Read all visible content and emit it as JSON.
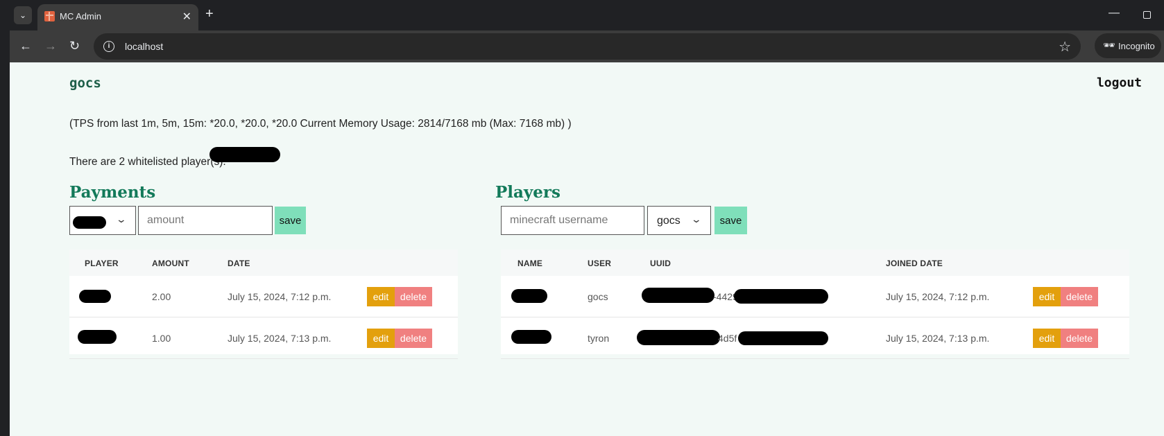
{
  "browser": {
    "tab_title": "MC Admin",
    "tab_close": "✕",
    "new_tab": "+",
    "url": "localhost",
    "incognito_label": "Incognito"
  },
  "header": {
    "username": "gocs",
    "logout_label": "logout"
  },
  "stats": {
    "tps_line": "(TPS from last 1m, 5m, 15m: *20.0, *20.0, *20.0 Current Memory Usage: 2814/7168 mb (Max: 7168 mb) )",
    "whitelist_line": "There are 2 whitelisted player(s):"
  },
  "payments": {
    "title": "Payments",
    "amount_placeholder": "amount",
    "save_label": "save",
    "columns": [
      "PLAYER",
      "AMOUNT",
      "DATE"
    ],
    "rows": [
      {
        "amount": "2.00",
        "date": "July 15, 2024, 7:12 p.m.",
        "edit": "edit",
        "delete": "delete"
      },
      {
        "amount": "1.00",
        "date": "July 15, 2024, 7:13 p.m.",
        "edit": "edit",
        "delete": "delete"
      }
    ]
  },
  "players": {
    "title": "Players",
    "username_placeholder": "minecraft username",
    "user_select_value": "gocs",
    "save_label": "save",
    "columns": [
      "NAME",
      "USER",
      "UUID",
      "JOINED DATE"
    ],
    "rows": [
      {
        "user": "gocs",
        "uuid_fragment": "-4429",
        "joined": "July 15, 2024, 7:12 p.m.",
        "edit": "edit",
        "delete": "delete"
      },
      {
        "user": "tyron",
        "uuid_fragment": "4d5f",
        "joined": "July 15, 2024, 7:13 p.m.",
        "edit": "edit",
        "delete": "delete"
      }
    ]
  },
  "colors": {
    "accent": "#137a5a",
    "save": "#7fdfba",
    "edit": "#e3a00d",
    "delete": "#f08080",
    "page_bg": "#f2f9f6"
  }
}
